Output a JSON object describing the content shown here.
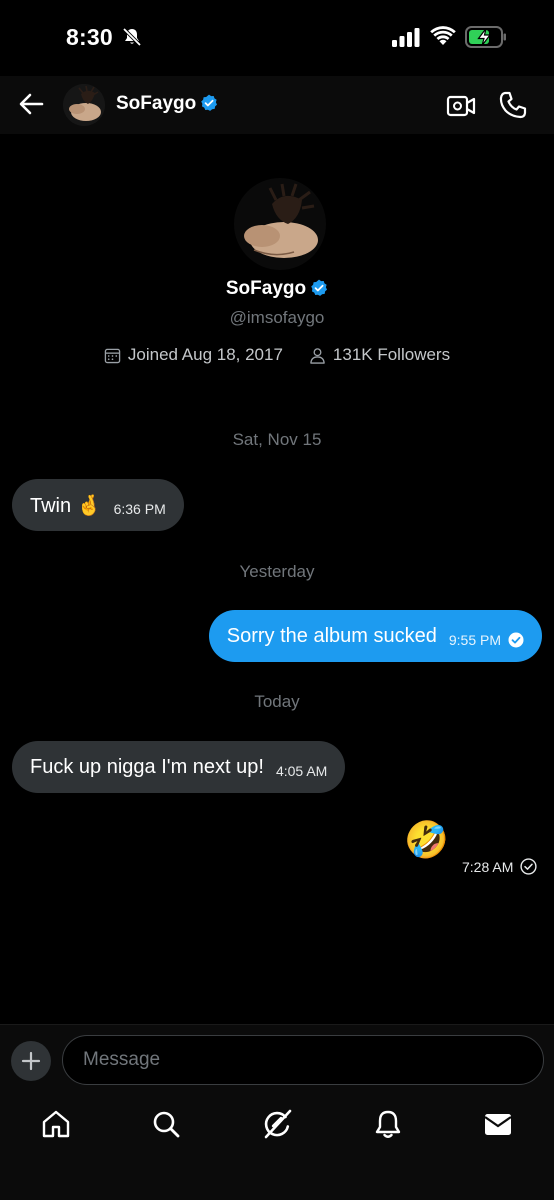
{
  "status_bar": {
    "time": "8:30"
  },
  "header": {
    "name": "SoFaygo",
    "verified": true,
    "avatar_icon": "profile-photo"
  },
  "profile": {
    "name": "SoFaygo",
    "handle": "@imsofaygo",
    "joined": "Joined Aug 18, 2017",
    "followers": "131K Followers"
  },
  "messages": [
    {
      "type": "date",
      "text": "Sat, Nov 15"
    },
    {
      "type": "received",
      "text": "Twin 🤞",
      "time": "6:36 PM"
    },
    {
      "type": "date",
      "text": "Yesterday"
    },
    {
      "type": "sent",
      "text": "Sorry the album sucked",
      "time": "9:55 PM",
      "status": "seen"
    },
    {
      "type": "date",
      "text": "Today"
    },
    {
      "type": "received",
      "text": "Fuck up nigga I'm next up!",
      "time": "4:05 AM"
    },
    {
      "type": "sent-emoji",
      "text": "🤣",
      "time": "7:28 AM",
      "status": "sent"
    }
  ],
  "composer": {
    "placeholder": "Message"
  },
  "nav": {
    "items": [
      "home-icon",
      "search-icon",
      "grok-icon",
      "notifications-icon",
      "messages-icon"
    ]
  },
  "colors": {
    "accent": "#1d9bf0",
    "received_bubble": "#2f3336",
    "background": "#000000",
    "muted_text": "#71767b"
  }
}
